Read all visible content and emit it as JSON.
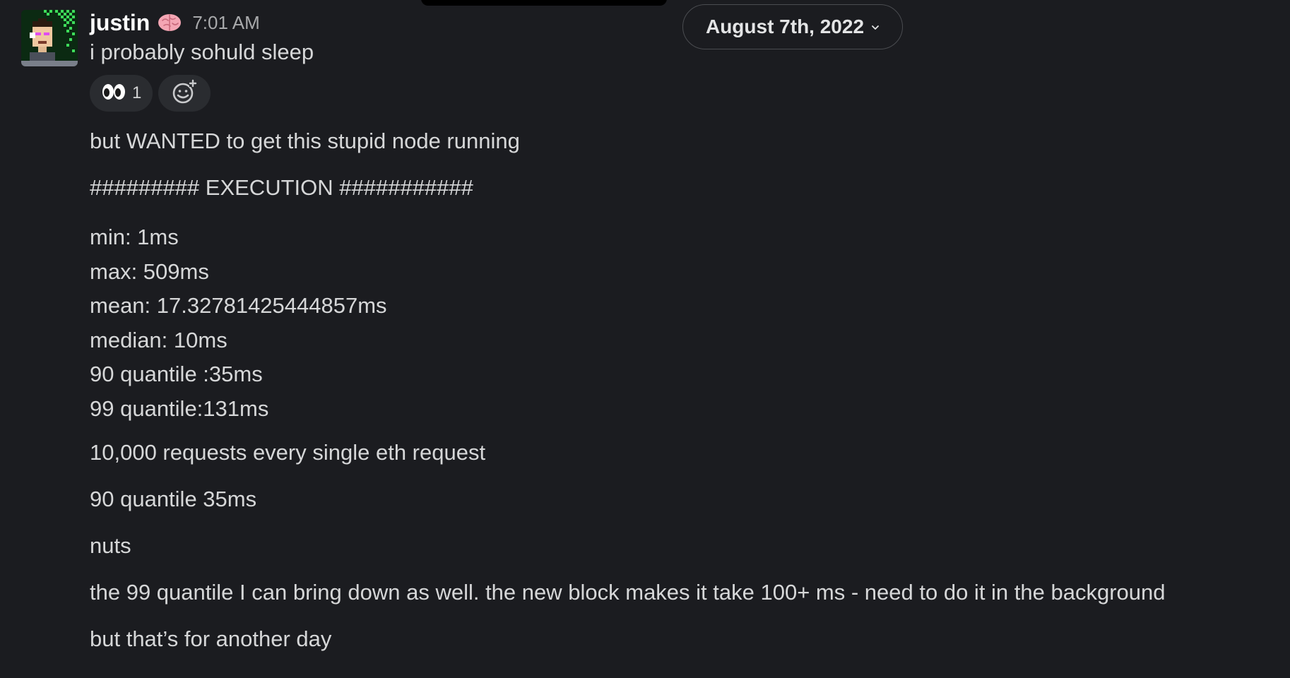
{
  "date_divider": {
    "label": "August 7th, 2022"
  },
  "message": {
    "author": "justin",
    "status_icon": "brain-icon",
    "time": "7:01 AM",
    "first_line": "i probably sohuld sleep",
    "reactions": [
      {
        "emoji_name": "eyes-icon",
        "count": "1"
      }
    ],
    "add_reaction_icon": "add-emoji-icon",
    "lines": {
      "l1": "but WANTED to get this stupid node running",
      "l2": "######### EXECUTION ###########",
      "stats": {
        "min": "min: 1ms",
        "max": "max: 509ms",
        "mean": "mean: 17.32781425444857ms",
        "median": "median: 10ms",
        "q90": "90 quantile :35ms",
        "q99": "99 quantile:131ms"
      },
      "l3": "10,000 requests every single eth request",
      "l4": "90 quantile 35ms",
      "l5": "nuts",
      "l6": "the 99 quantile I can bring down as well. the new block makes it take 100+ ms - need to do it in the background",
      "l7": "but that’s for another day"
    }
  },
  "colors": {
    "background": "#1b1c20",
    "text": "#d6d7d8",
    "username": "#ffffff",
    "timestamp": "#a8a9ab",
    "reaction_bg": "#2a2c30"
  }
}
